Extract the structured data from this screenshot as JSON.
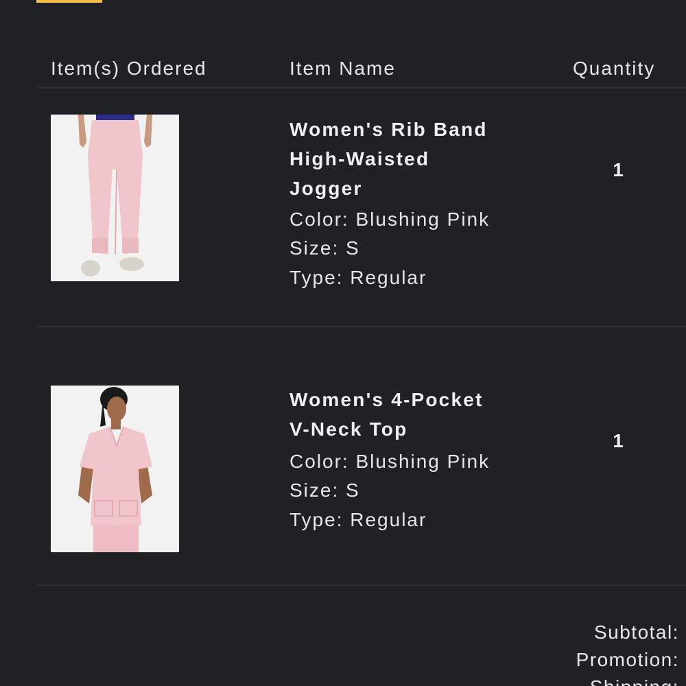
{
  "columns": {
    "items_ordered": "Item(s) Ordered",
    "item_name": "Item Name",
    "quantity": "Quantity"
  },
  "items": [
    {
      "image_icon": "pink-jogger-product-photo",
      "name_line1": "Women's Rib Band",
      "name_line2": "High-Waisted",
      "name_line3": "Jogger",
      "color": "Color: Blushing Pink",
      "size": "Size: S",
      "type": "Type: Regular",
      "quantity": "1"
    },
    {
      "image_icon": "pink-vneck-top-product-photo",
      "name_line1": "Women's 4-Pocket",
      "name_line2": "V-Neck Top",
      "color": "Color: Blushing Pink",
      "size": "Size: S",
      "type": "Type: Regular",
      "quantity": "1"
    }
  ],
  "summary": {
    "subtotal_label": "Subtotal:",
    "promotion_label": "Promotion:",
    "shipping_label": "Shipping:"
  },
  "colors": {
    "background": "#202124",
    "accent": "#f5c04a",
    "product_pink": "#f2c8cc"
  }
}
